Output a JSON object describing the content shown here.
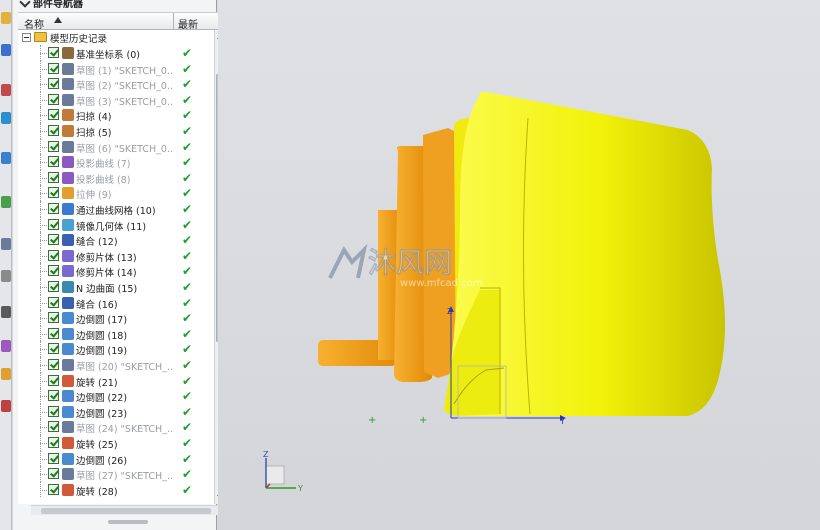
{
  "panel": {
    "title": "部件导航器",
    "col_name": "名称",
    "col_latest": "最新"
  },
  "tree": {
    "root_label": "模型历史记录",
    "items": [
      {
        "label": "基准坐标系 (0)",
        "icon": "datum-csys-icon",
        "dim": false
      },
      {
        "label": "草图 (1) \"SKETCH_0...",
        "icon": "sketch-icon",
        "dim": true
      },
      {
        "label": "草图 (2) \"SKETCH_0...",
        "icon": "sketch-icon",
        "dim": true
      },
      {
        "label": "草图 (3) \"SKETCH_0...",
        "icon": "sketch-icon",
        "dim": true
      },
      {
        "label": "扫掠 (4)",
        "icon": "sweep-icon",
        "dim": false
      },
      {
        "label": "扫掠 (5)",
        "icon": "sweep-icon",
        "dim": false
      },
      {
        "label": "草图 (6) \"SKETCH_0...",
        "icon": "sketch-icon",
        "dim": true
      },
      {
        "label": "投影曲线 (7)",
        "icon": "project-curve-icon",
        "dim": true
      },
      {
        "label": "投影曲线 (8)",
        "icon": "project-curve-icon",
        "dim": true
      },
      {
        "label": "拉伸 (9)",
        "icon": "extrude-icon",
        "dim": true
      },
      {
        "label": "通过曲线网格 (10)",
        "icon": "curve-mesh-icon",
        "dim": false
      },
      {
        "label": "镜像几何体 (11)",
        "icon": "mirror-icon",
        "dim": false
      },
      {
        "label": "缝合 (12)",
        "icon": "sew-icon",
        "dim": false
      },
      {
        "label": "修剪片体 (13)",
        "icon": "trim-sheet-icon",
        "dim": false
      },
      {
        "label": "修剪片体 (14)",
        "icon": "trim-sheet-icon",
        "dim": false
      },
      {
        "label": "N 边曲面 (15)",
        "icon": "n-sided-surface-icon",
        "dim": false
      },
      {
        "label": "缝合 (16)",
        "icon": "sew-icon",
        "dim": false
      },
      {
        "label": "边倒圆 (17)",
        "icon": "edge-blend-icon",
        "dim": false
      },
      {
        "label": "边倒圆 (18)",
        "icon": "edge-blend-icon",
        "dim": false
      },
      {
        "label": "边倒圆 (19)",
        "icon": "edge-blend-icon",
        "dim": false
      },
      {
        "label": "草图 (20) \"SKETCH_...",
        "icon": "sketch-icon",
        "dim": true
      },
      {
        "label": "旋转 (21)",
        "icon": "revolve-icon",
        "dim": false
      },
      {
        "label": "边倒圆 (22)",
        "icon": "edge-blend-icon",
        "dim": false
      },
      {
        "label": "边倒圆 (23)",
        "icon": "edge-blend-icon",
        "dim": false
      },
      {
        "label": "草图 (24) \"SKETCH_...",
        "icon": "sketch-icon",
        "dim": true
      },
      {
        "label": "旋转 (25)",
        "icon": "revolve-icon",
        "dim": false
      },
      {
        "label": "边倒圆 (26)",
        "icon": "edge-blend-icon",
        "dim": false
      },
      {
        "label": "草图 (27) \"SKETCH_...",
        "icon": "sketch-icon",
        "dim": true
      },
      {
        "label": "旋转 (28)",
        "icon": "revolve-icon",
        "dim": false
      }
    ],
    "latest_mark": "✔"
  },
  "viewport": {
    "watermark_text": "沐风网",
    "watermark_url": "www.mfcad.com",
    "axis_z": "Z",
    "axis_y": "Y",
    "triad_z": "Z",
    "triad_y": "Y"
  },
  "colors": {
    "model_yellow": "#f2f20a",
    "handle_orange": "#f5a51a",
    "check_green": "#1e9e2e"
  }
}
